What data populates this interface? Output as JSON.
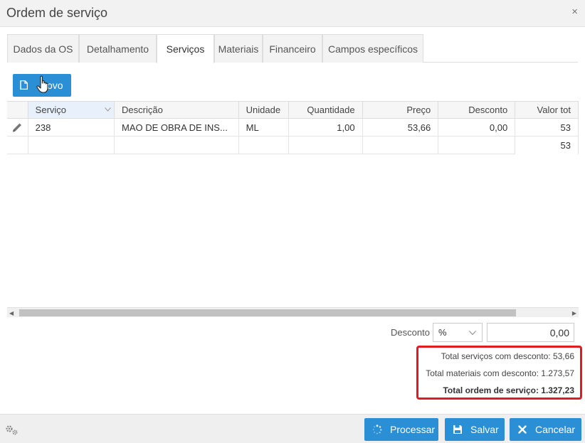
{
  "window": {
    "title": "Ordem de serviço",
    "close_glyph": "×"
  },
  "tabs": [
    {
      "label": "Dados da OS"
    },
    {
      "label": "Detalhamento"
    },
    {
      "label": "Serviços"
    },
    {
      "label": "Materiais"
    },
    {
      "label": "Financeiro"
    },
    {
      "label": "Campos específicos"
    }
  ],
  "active_tab": "Serviços",
  "toolbar": {
    "new_label": "ovo"
  },
  "grid": {
    "columns": [
      "Serviço",
      "Descrição",
      "Unidade",
      "Quantidade",
      "Preço",
      "Desconto",
      "Valor tot"
    ],
    "rows": [
      {
        "servico": "238",
        "descricao": "MAO DE OBRA DE INS...",
        "unidade": "ML",
        "quantidade": "1,00",
        "preco": "53,66",
        "desconto": "0,00",
        "valor_total": "53"
      }
    ],
    "summary_row": {
      "valor_total": "53"
    }
  },
  "discount": {
    "label": "Desconto",
    "type_value": "%",
    "value": "0,00"
  },
  "totals": {
    "services": "Total serviços com desconto: 53,66",
    "materials": "Total materiais com desconto: 1.273,57",
    "order": "Total ordem de serviço: 1.327,23"
  },
  "footer": {
    "process_label": "Processar",
    "save_label": "Salvar",
    "cancel_label": "Cancelar"
  },
  "colors": {
    "primary": "#2a8fd4",
    "highlight_border": "#e11b22"
  }
}
